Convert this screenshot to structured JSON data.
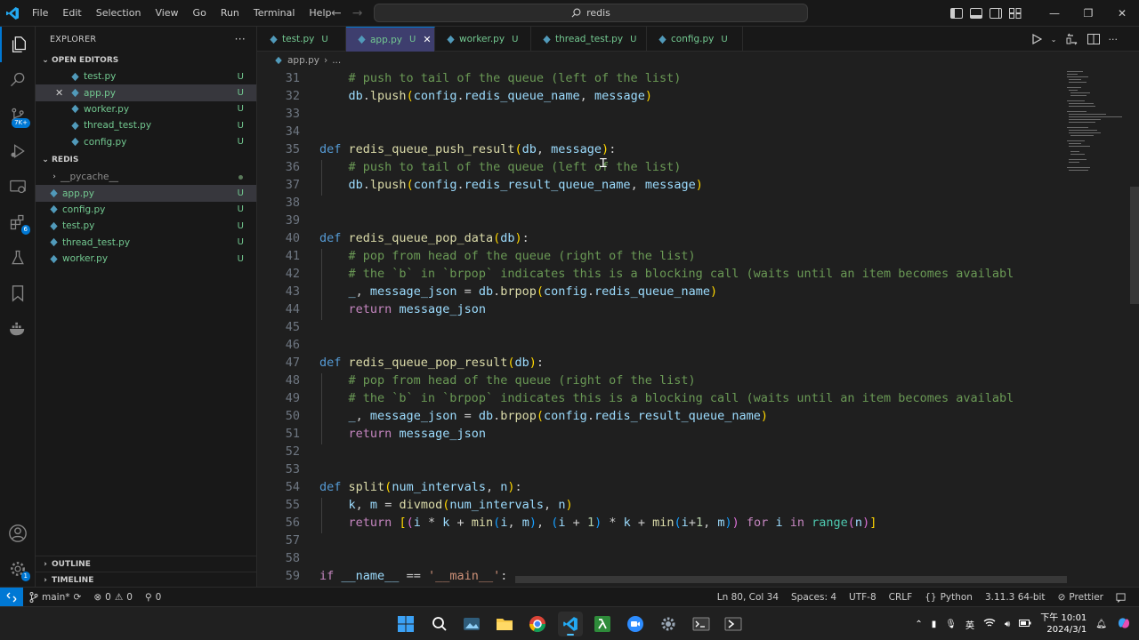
{
  "menu": [
    "File",
    "Edit",
    "Selection",
    "View",
    "Go",
    "Run",
    "Terminal",
    "Help"
  ],
  "search": {
    "text": "redis"
  },
  "explorer": {
    "title": "EXPLORER",
    "more": "···",
    "open_editors_label": "OPEN EDITORS",
    "open_editors": [
      {
        "name": "test.py",
        "status": "U"
      },
      {
        "name": "app.py",
        "status": "U"
      },
      {
        "name": "worker.py",
        "status": "U"
      },
      {
        "name": "thread_test.py",
        "status": "U"
      },
      {
        "name": "config.py",
        "status": "U"
      }
    ],
    "folder_label": "REDIS",
    "pycache": "__pycache__",
    "files": [
      {
        "name": "app.py",
        "status": "U"
      },
      {
        "name": "config.py",
        "status": "U"
      },
      {
        "name": "test.py",
        "status": "U"
      },
      {
        "name": "thread_test.py",
        "status": "U"
      },
      {
        "name": "worker.py",
        "status": "U"
      }
    ],
    "outline_label": "OUTLINE",
    "timeline_label": "TIMELINE"
  },
  "activity_badges": {
    "scm": "7K+",
    "extensions": "6",
    "accounts": "1"
  },
  "tabs": [
    {
      "name": "test.py",
      "status": "U"
    },
    {
      "name": "app.py",
      "status": "U",
      "close": "✕"
    },
    {
      "name": "worker.py",
      "status": "U"
    },
    {
      "name": "thread_test.py",
      "status": "U"
    },
    {
      "name": "config.py",
      "status": "U"
    }
  ],
  "breadcrumb": {
    "file": "app.py",
    "sep": "›",
    "rest": "..."
  },
  "editor": {
    "line_numbers": [
      "31",
      "32",
      "33",
      "34",
      "35",
      "36",
      "37",
      "38",
      "39",
      "40",
      "41",
      "42",
      "43",
      "44",
      "45",
      "46",
      "47",
      "48",
      "49",
      "50",
      "51",
      "52",
      "53",
      "54",
      "55",
      "56",
      "57",
      "58",
      "59"
    ]
  },
  "status": {
    "branch": "main*",
    "errors": "0",
    "warnings": "0",
    "ports": "0",
    "position": "Ln 80, Col 34",
    "spaces": "Spaces: 4",
    "encoding": "UTF-8",
    "eol": "CRLF",
    "language": "Python",
    "interpreter": "3.11.3 64-bit",
    "formatter": "Prettier"
  },
  "taskbar": {
    "ime": "英",
    "time": "下午 10:01",
    "date": "2024/3/1"
  },
  "colors": {
    "accent": "#0078d4",
    "untracked": "#73c991",
    "active_tab": "#3e3e6e"
  }
}
